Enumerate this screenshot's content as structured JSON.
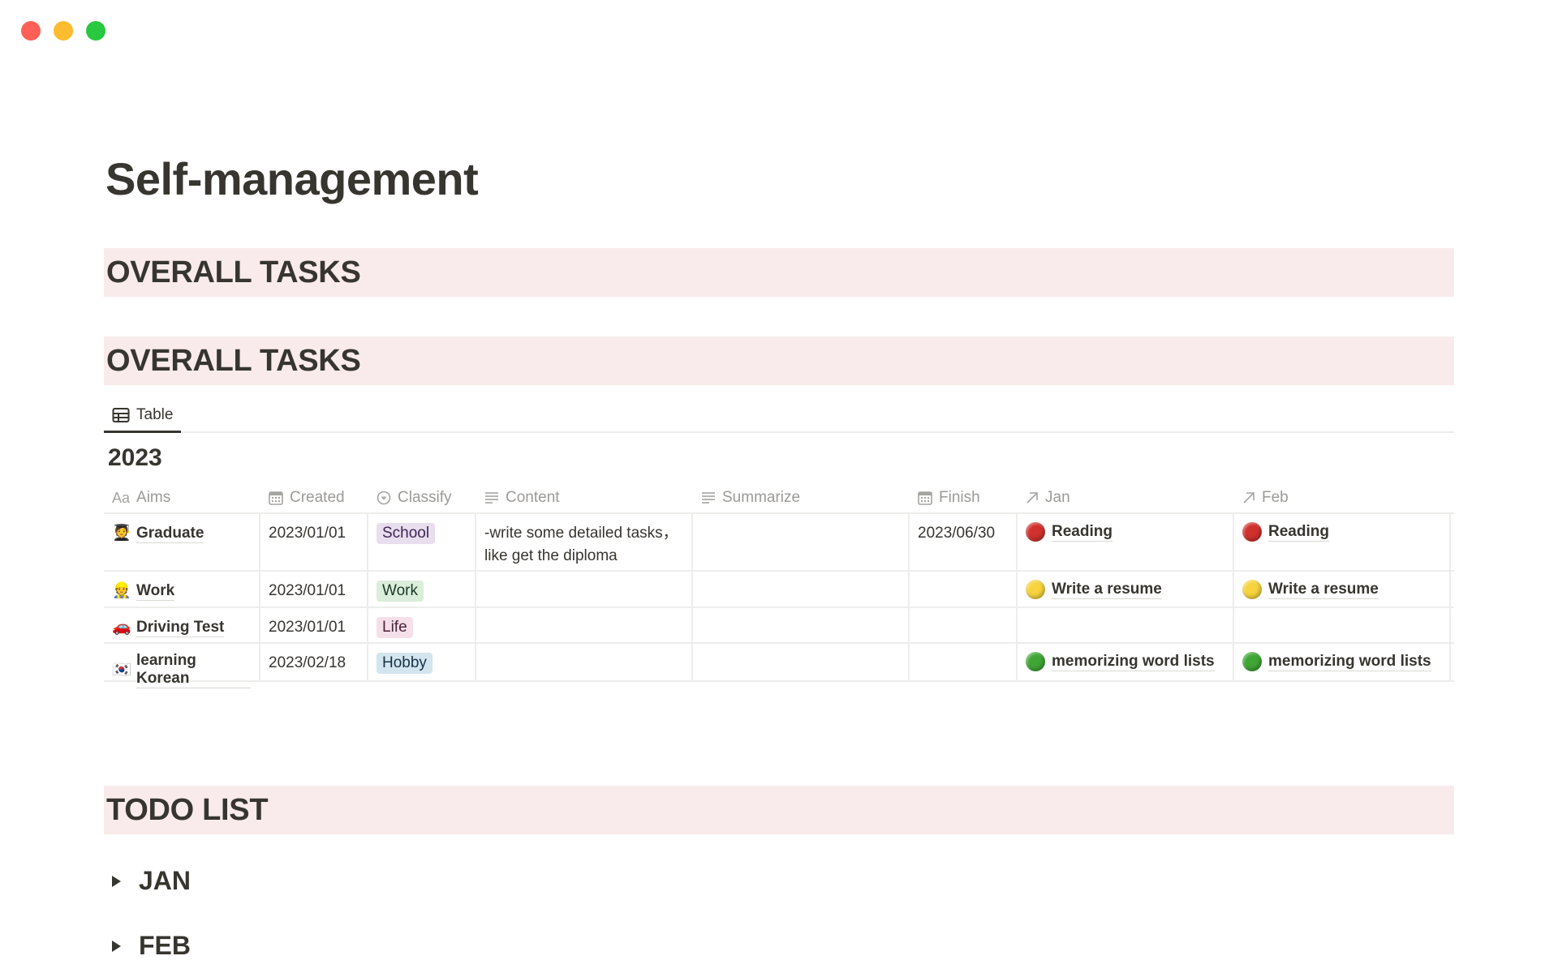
{
  "window": {
    "controls": [
      {
        "name": "close",
        "color": "#ff5f57"
      },
      {
        "name": "minimize",
        "color": "#febc2e"
      },
      {
        "name": "zoom",
        "color": "#28c840"
      }
    ]
  },
  "page": {
    "title": "Self-management"
  },
  "sections": {
    "overall_heading_1": "OVERALL TASKS",
    "overall_heading_2": "OVERALL TASKS",
    "todo_heading": "TODO LIST"
  },
  "database": {
    "view_tab": {
      "label": "Table",
      "icon": "table-icon"
    },
    "group_title": "2023",
    "columns": [
      {
        "key": "aims",
        "label": "Aims",
        "icon": "text-type-icon"
      },
      {
        "key": "created",
        "label": "Created",
        "icon": "calendar-icon"
      },
      {
        "key": "classify",
        "label": "Classify",
        "icon": "select-icon"
      },
      {
        "key": "content",
        "label": "Content",
        "icon": "text-lines-icon"
      },
      {
        "key": "summarize",
        "label": "Summarize",
        "icon": "text-lines-icon"
      },
      {
        "key": "finish",
        "label": "Finish",
        "icon": "calendar-icon"
      },
      {
        "key": "jan",
        "label": "Jan",
        "icon": "relation-arrow-icon"
      },
      {
        "key": "feb",
        "label": "Feb",
        "icon": "relation-arrow-icon"
      }
    ],
    "rows": [
      {
        "emoji": "🧑‍🎓",
        "aims": "Graduate",
        "created": "2023/01/01",
        "classify": {
          "label": "School",
          "bg": "#e8deee",
          "fg": "#412454"
        },
        "content": "-write some detailed tasks，like get the diploma",
        "summarize": "",
        "finish": "2023/06/30",
        "jan": {
          "label": "Reading",
          "dot": "#d0312d"
        },
        "feb": {
          "label": "Reading",
          "dot": "#d0312d"
        }
      },
      {
        "emoji": "👷",
        "aims": "Work",
        "created": "2023/01/01",
        "classify": {
          "label": "Work",
          "bg": "#dbeddb",
          "fg": "#1c3829"
        },
        "content": "",
        "summarize": "",
        "finish": "",
        "jan": {
          "label": "Write a resume",
          "dot": "#f7d33e"
        },
        "feb": {
          "label": "Write a resume",
          "dot": "#f7d33e"
        }
      },
      {
        "emoji": "🚗",
        "aims": "Driving Test",
        "created": "2023/01/01",
        "classify": {
          "label": "Life",
          "bg": "#f5e0e9",
          "fg": "#4c2337"
        },
        "content": "",
        "summarize": "",
        "finish": "",
        "jan": {
          "label": "",
          "dot": ""
        },
        "feb": {
          "label": "",
          "dot": ""
        }
      },
      {
        "emoji": "🇰🇷",
        "aims": "learning Korean",
        "created": "2023/02/18",
        "classify": {
          "label": "Hobby",
          "bg": "#d3e5ef",
          "fg": "#183347"
        },
        "content": "",
        "summarize": "",
        "finish": "",
        "jan": {
          "label": "memorizing word lists",
          "dot": "#3fa535"
        },
        "feb": {
          "label": "memorizing word lists",
          "dot": "#3fa535"
        }
      }
    ]
  },
  "todo": {
    "toggles": [
      {
        "label": "JAN"
      },
      {
        "label": "FEB"
      }
    ]
  },
  "colors": {
    "text": "#37352f",
    "muted": "#9b9a97",
    "heading_band": "#f9ebeb",
    "divider": "#ededec"
  }
}
